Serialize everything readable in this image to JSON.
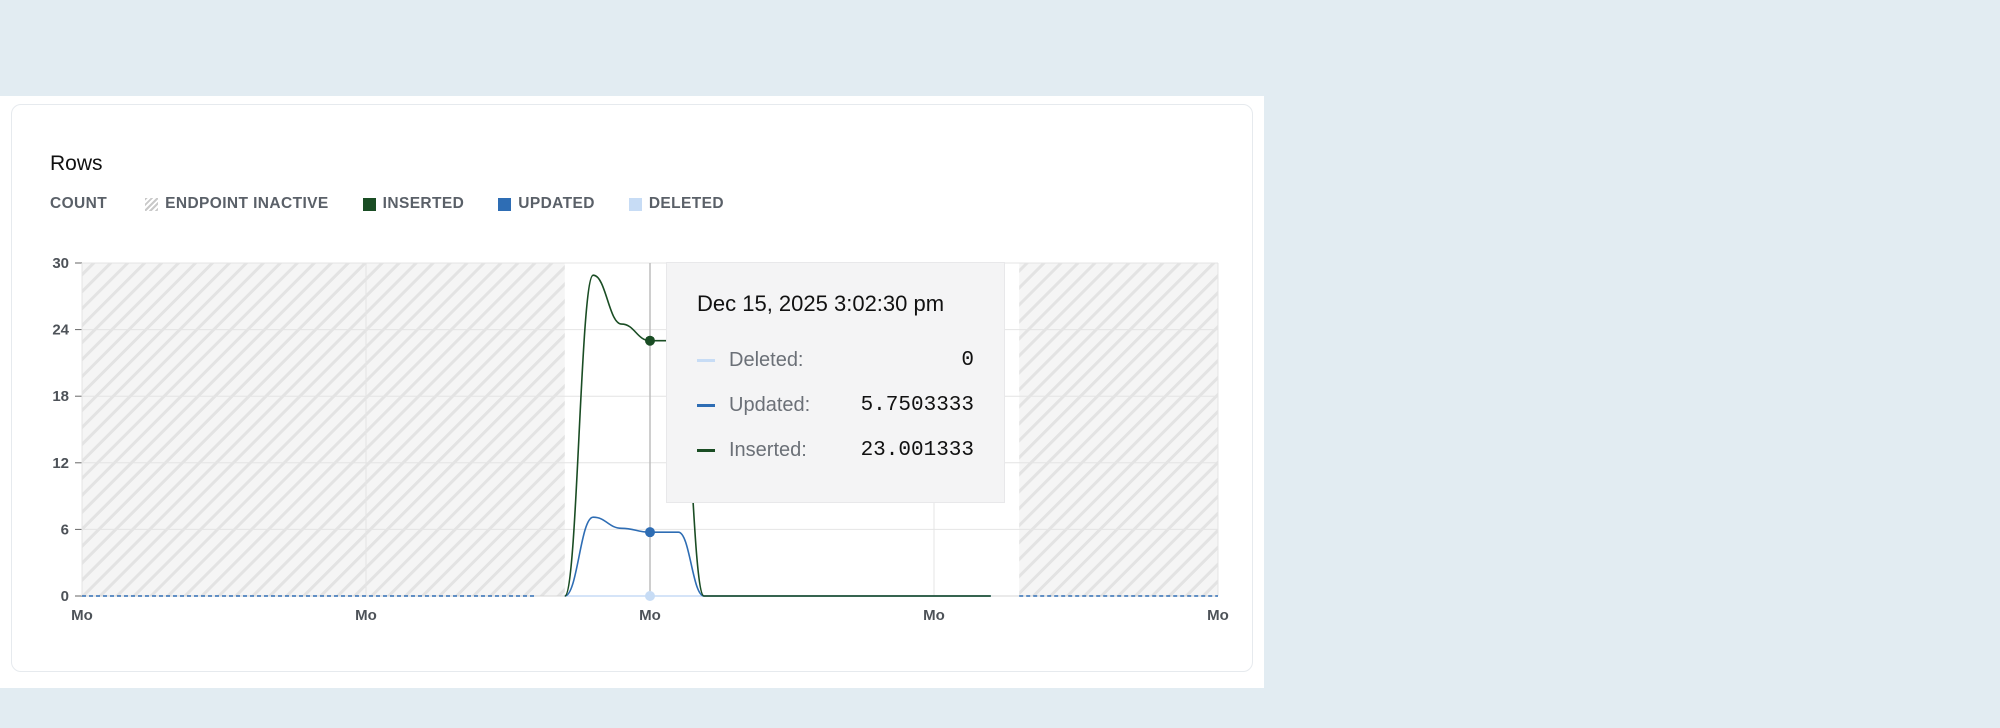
{
  "card": {
    "title": "Rows"
  },
  "legend": {
    "count_label": "COUNT",
    "items": [
      {
        "label": "ENDPOINT INACTIVE",
        "color": "#c9c9c9",
        "style": "hatch"
      },
      {
        "label": "INSERTED",
        "color": "#1a4d24"
      },
      {
        "label": "UPDATED",
        "color": "#2e6db4"
      },
      {
        "label": "DELETED",
        "color": "#c7dcf5"
      }
    ]
  },
  "tooltip": {
    "timestamp": "Dec 15, 2025 3:02:30 pm",
    "rows": [
      {
        "label": "Deleted:",
        "value": "0",
        "color": "#c7dcf5"
      },
      {
        "label": "Updated:",
        "value": "5.7503333",
        "color": "#2e6db4"
      },
      {
        "label": "Inserted:",
        "value": "23.001333",
        "color": "#1a4d24"
      }
    ]
  },
  "chart_data": {
    "type": "line",
    "title": "Rows",
    "ylabel": "COUNT",
    "ylim": [
      0,
      30
    ],
    "yticks": [
      0,
      6,
      12,
      18,
      24,
      30
    ],
    "xlim": [
      0,
      4
    ],
    "xticks": [
      0,
      1,
      2,
      3,
      4
    ],
    "xtick_labels": [
      "Mo",
      "Mo",
      "Mo",
      "Mo",
      "Mo"
    ],
    "grid": true,
    "legend_position": "top-left",
    "inactive_ranges": [
      [
        0,
        1.7
      ],
      [
        3.3,
        4
      ]
    ],
    "active_range": [
      1.7,
      3.2
    ],
    "hover_x": 2.0,
    "series": [
      {
        "name": "INSERTED",
        "color": "#1a4d24",
        "x": [
          1.7,
          1.8,
          1.9,
          2.0,
          2.1,
          2.19,
          2.3,
          2.6,
          2.9,
          3.2
        ],
        "y": [
          0,
          28.9,
          24.5,
          23.0,
          23.0,
          0,
          0,
          0,
          0,
          0
        ]
      },
      {
        "name": "UPDATED",
        "color": "#2e6db4",
        "x": [
          1.7,
          1.8,
          1.9,
          2.0,
          2.1,
          2.19,
          2.3,
          2.6,
          2.9,
          3.2
        ],
        "y": [
          0,
          7.1,
          6.1,
          5.75,
          5.75,
          0,
          0,
          0,
          0,
          0
        ]
      },
      {
        "name": "DELETED",
        "color": "#c7dcf5",
        "x": [
          1.7,
          2.0,
          2.3,
          2.6,
          2.9,
          3.2
        ],
        "y": [
          0,
          0,
          0,
          0,
          0,
          0
        ]
      }
    ]
  }
}
